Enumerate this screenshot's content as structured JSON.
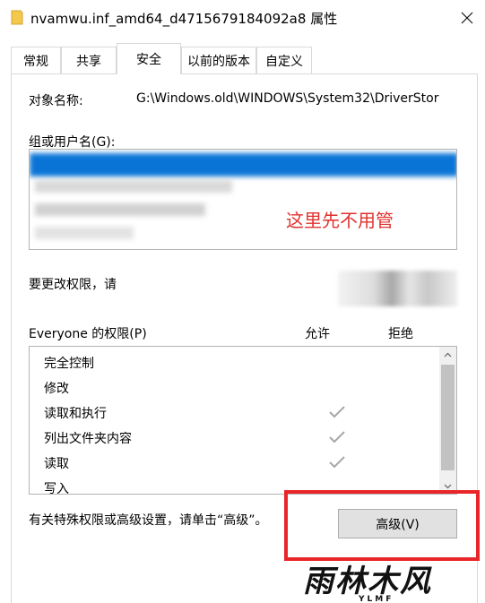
{
  "window": {
    "title": "nvamwu.inf_amd64_d4715679184092a8 属性",
    "close_icon": "close-icon",
    "folder_icon": "folder-icon"
  },
  "tabs": [
    {
      "label": "常规",
      "active": false
    },
    {
      "label": "共享",
      "active": false
    },
    {
      "label": "安全",
      "active": true
    },
    {
      "label": "以前的版本",
      "active": false
    },
    {
      "label": "自定义",
      "active": false
    }
  ],
  "object": {
    "label": "对象名称:",
    "value": "G:\\Windows.old\\WINDOWS\\System32\\DriverStor"
  },
  "groups": {
    "label": "组或用户名(G):",
    "note": "这里先不用管"
  },
  "edit": {
    "label": "要更改权限，请"
  },
  "permissions": {
    "label": "Everyone 的权限(P)",
    "allow_header": "允许",
    "deny_header": "拒绝",
    "rows": [
      {
        "name": "完全控制",
        "allow": false
      },
      {
        "name": "修改",
        "allow": false
      },
      {
        "name": "读取和执行",
        "allow": true
      },
      {
        "name": "列出文件夹内容",
        "allow": true
      },
      {
        "name": "读取",
        "allow": true
      },
      {
        "name": "写入",
        "allow": false
      }
    ]
  },
  "advanced": {
    "hint": "有关特殊权限或高级设置，请单击“高级”。",
    "button_label": "高级(V)"
  },
  "watermark": {
    "main": "雨林木风",
    "sub": "YLMF"
  },
  "colors": {
    "selection": "#0078d7",
    "annotation": "#e8262a"
  }
}
